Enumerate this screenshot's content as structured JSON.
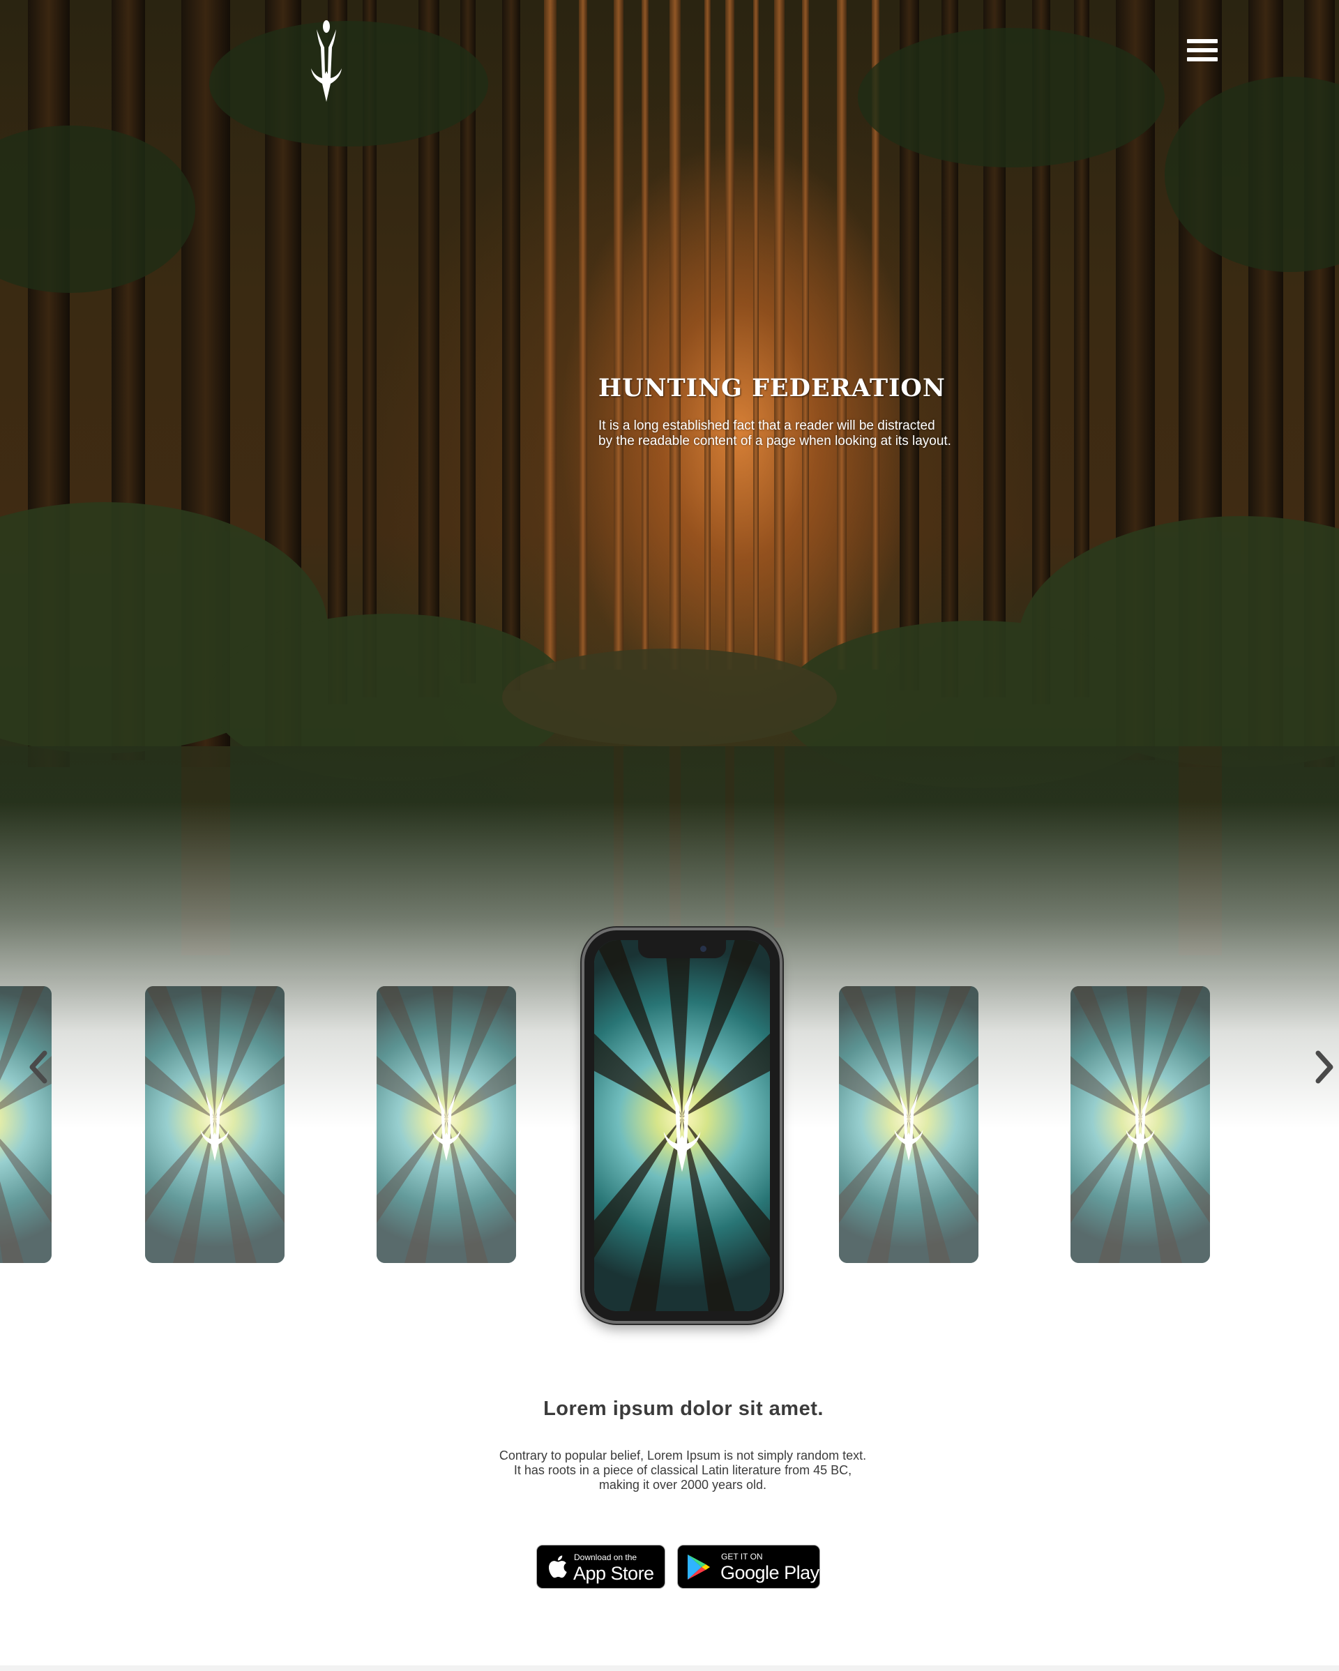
{
  "header": {
    "logo_icon": "antler-logo-icon",
    "menu_icon": "hamburger-menu-icon"
  },
  "hero": {
    "title": "HUNTING FEDERATION",
    "description_line1": "It is a long established fact that a reader will be distracted",
    "description_line2": "by the readable content of a page when looking at its layout."
  },
  "carousel": {
    "prev_icon": "chevron-left-icon",
    "next_icon": "chevron-right-icon",
    "slides": 6
  },
  "section": {
    "title": "Lorem ipsum dolor sit amet.",
    "body_line1": "Contrary to popular belief, Lorem Ipsum is not simply random text.",
    "body_line2": "It has roots in a piece of classical Latin literature from 45 BC,",
    "body_line3": "making it over 2000 years old."
  },
  "stores": {
    "apple": {
      "small": "Download on the",
      "big": "App Store",
      "icon": "apple-icon"
    },
    "google": {
      "small": "GET IT ON",
      "big": "Google Play",
      "icon": "google-play-icon"
    }
  },
  "colors": {
    "text_dark": "#3b3b3b",
    "store_button_bg": "#000000",
    "hero_text": "#ffffff"
  }
}
